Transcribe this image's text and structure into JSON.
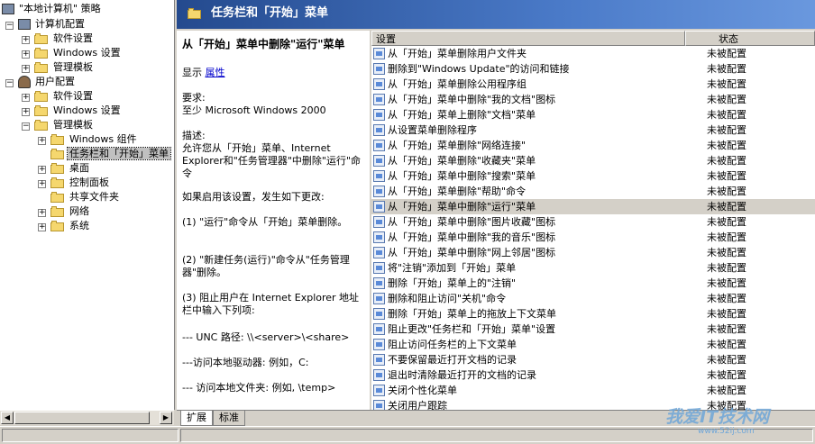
{
  "tree": {
    "root": "\"本地计算机\" 策略",
    "items": [
      {
        "label": "计算机配置"
      },
      {
        "label": "软件设置"
      },
      {
        "label": "Windows 设置"
      },
      {
        "label": "管理模板"
      },
      {
        "label": "用户配置"
      },
      {
        "label": "软件设置"
      },
      {
        "label": "Windows 设置"
      },
      {
        "label": "管理模板"
      },
      {
        "label": "Windows 组件"
      },
      {
        "label": "任务栏和「开始」菜单"
      },
      {
        "label": "桌面"
      },
      {
        "label": "控制面板"
      },
      {
        "label": "共享文件夹"
      },
      {
        "label": "网络"
      },
      {
        "label": "系统"
      }
    ]
  },
  "banner": {
    "title": "任务栏和「开始」菜单"
  },
  "description": {
    "heading": "从「开始」菜单中删除\"运行\"菜单",
    "show_label": "显示",
    "properties_link": "属性",
    "req_label": "要求:",
    "req_value": "至少 Microsoft Windows 2000",
    "desc_label": "描述:",
    "desc_text": "允许您从「开始」菜单、Internet Explorer和\"任务管理器\"中删除\"运行\"命令",
    "para1": "如果启用该设置，发生如下更改:",
    "para2": "(1) \"运行\"命令从「开始」菜单删除。",
    "para3": "(2) \"新建任务(运行)\"命令从\"任务管理器\"删除。",
    "para4": "(3) 阻止用户在 Internet Explorer 地址栏中输入下列项:",
    "para5": "--- UNC 路径: \\\\<server>\\<share>",
    "para6": "---访问本地驱动器: 例如，C:",
    "para7": "--- 访问本地文件夹: 例如, \\temp>"
  },
  "list": {
    "col_setting": "设置",
    "col_state": "状态",
    "rows": [
      {
        "name": "从「开始」菜单删除用户文件夹",
        "state": "未被配置"
      },
      {
        "name": "删除到\"Windows Update\"的访问和链接",
        "state": "未被配置"
      },
      {
        "name": "从「开始」菜单删除公用程序组",
        "state": "未被配置"
      },
      {
        "name": "从「开始」菜单中删除\"我的文档\"图标",
        "state": "未被配置"
      },
      {
        "name": "从「开始」菜单上删除\"文档\"菜单",
        "state": "未被配置"
      },
      {
        "name": "从设置菜单删除程序",
        "state": "未被配置"
      },
      {
        "name": "从「开始」菜单删除\"网络连接\"",
        "state": "未被配置"
      },
      {
        "name": "从「开始」菜单删除\"收藏夹\"菜单",
        "state": "未被配置"
      },
      {
        "name": "从「开始」菜单中删除\"搜索\"菜单",
        "state": "未被配置"
      },
      {
        "name": "从「开始」菜单删除\"帮助\"命令",
        "state": "未被配置"
      },
      {
        "name": "从「开始」菜单中删除\"运行\"菜单",
        "state": "未被配置"
      },
      {
        "name": "从「开始」菜单中删除\"图片收藏\"图标",
        "state": "未被配置"
      },
      {
        "name": "从「开始」菜单中删除\"我的音乐\"图标",
        "state": "未被配置"
      },
      {
        "name": "从「开始」菜单中删除\"网上邻居\"图标",
        "state": "未被配置"
      },
      {
        "name": "将\"注销\"添加到「开始」菜单",
        "state": "未被配置"
      },
      {
        "name": "删除「开始」菜单上的\"注销\"",
        "state": "未被配置"
      },
      {
        "name": "删除和阻止访问\"关机\"命令",
        "state": "未被配置"
      },
      {
        "name": "删除「开始」菜单上的拖放上下文菜单",
        "state": "未被配置"
      },
      {
        "name": "阻止更改\"任务栏和「开始」菜单\"设置",
        "state": "未被配置"
      },
      {
        "name": "阻止访问任务栏的上下文菜单",
        "state": "未被配置"
      },
      {
        "name": "不要保留最近打开文档的记录",
        "state": "未被配置"
      },
      {
        "name": "退出时清除最近打开的文档的记录",
        "state": "未被配置"
      },
      {
        "name": "关闭个性化菜单",
        "state": "未被配置"
      },
      {
        "name": "关闭用户跟踪",
        "state": "未被配置"
      }
    ]
  },
  "tabs": [
    {
      "label": "扩展"
    },
    {
      "label": "标准"
    }
  ],
  "watermark": {
    "text": "我爱IT技术网",
    "url": "www.52ij.com"
  }
}
